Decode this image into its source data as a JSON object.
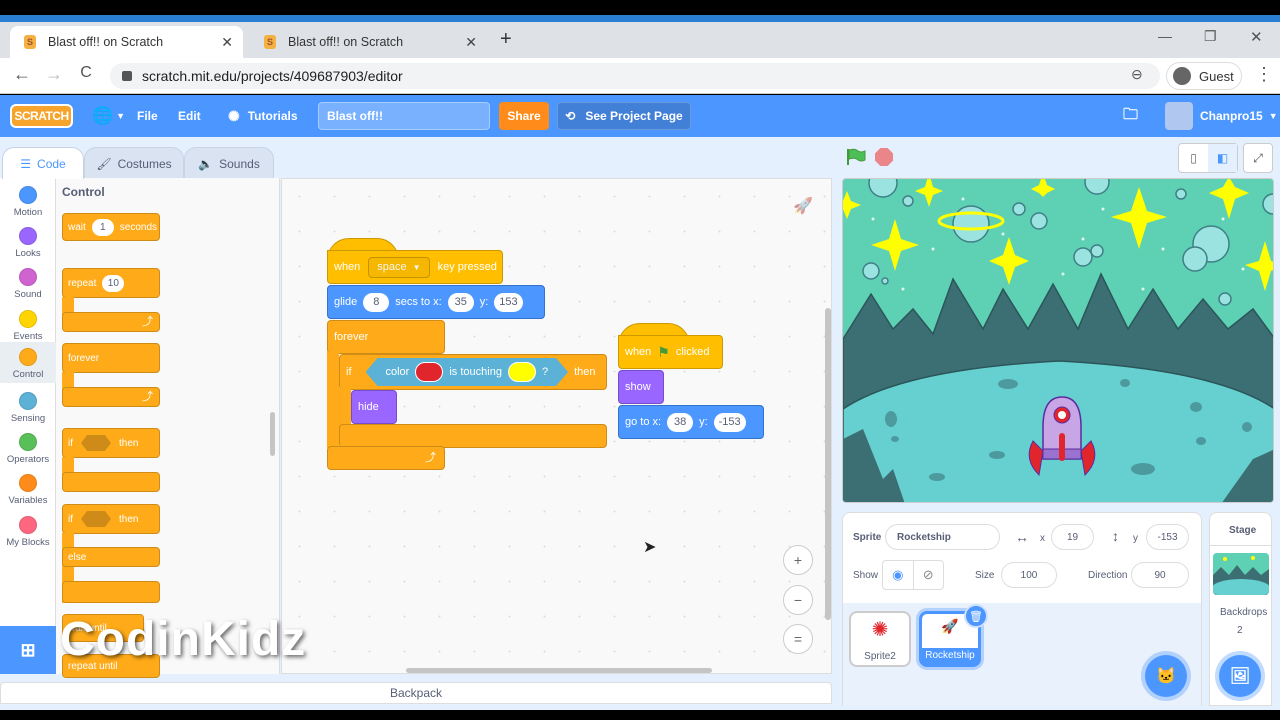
{
  "browser": {
    "tabs": [
      {
        "title": "Blast off!! on Scratch",
        "favicon": "S",
        "active": true
      },
      {
        "title": "Blast off!! on Scratch",
        "favicon": "S",
        "active": false
      }
    ],
    "new_tab": "+",
    "url": "scratch.mit.edu/projects/409687903/editor",
    "profile": "Guest",
    "window_controls": {
      "minimize": "—",
      "restore": "❐",
      "close": "✕"
    },
    "nav": {
      "back": "←",
      "forward": "→",
      "reload": "C"
    }
  },
  "menubar": {
    "logo": "SCRATCH",
    "globe_icon": "globe",
    "file": "File",
    "edit": "Edit",
    "tutorials": "Tutorials",
    "project_title": "Blast off!!",
    "share": "Share",
    "see_project_page": "See Project Page",
    "username": "Chanpro15"
  },
  "editor_tabs": [
    {
      "label": "Code",
      "icon": "code-icon",
      "active": true
    },
    {
      "label": "Costumes",
      "icon": "brush-icon",
      "active": false
    },
    {
      "label": "Sounds",
      "icon": "speaker-icon",
      "active": false
    }
  ],
  "categories": [
    {
      "label": "Motion",
      "color": "#4c97ff"
    },
    {
      "label": "Looks",
      "color": "#9966ff"
    },
    {
      "label": "Sound",
      "color": "#cf63cf"
    },
    {
      "label": "Events",
      "color": "#ffd500"
    },
    {
      "label": "Control",
      "color": "#ffab19",
      "active": true
    },
    {
      "label": "Sensing",
      "color": "#5cb1d6"
    },
    {
      "label": "Operators",
      "color": "#59c059"
    },
    {
      "label": "Variables",
      "color": "#ff8c1a"
    },
    {
      "label": "My Blocks",
      "color": "#ff6680"
    }
  ],
  "palette": {
    "title": "Control",
    "wait": {
      "label": "wait",
      "value": "1",
      "suffix": "seconds"
    },
    "repeat": {
      "label": "repeat",
      "value": "10"
    },
    "forever": "forever",
    "if_then": {
      "if": "if",
      "then": "then"
    },
    "if_else": {
      "if": "if",
      "then": "then",
      "else": "else"
    },
    "wait_until": "wait until",
    "repeat_until": "repeat until"
  },
  "scripts": {
    "script1": {
      "hat": {
        "when": "when",
        "key": "space",
        "suffix": "key pressed"
      },
      "glide": {
        "label": "glide",
        "secs": "8",
        "mid": "secs to x:",
        "x": "35",
        "ylabel": "y:",
        "y": "153"
      },
      "forever": "forever",
      "if": {
        "if": "if",
        "color": "color",
        "touching": "is touching",
        "q": "?",
        "then": "then",
        "color1": "#e0262c",
        "color2": "#ffff00"
      },
      "hide": "hide"
    },
    "script2": {
      "hat": {
        "when": "when",
        "suffix": "clicked"
      },
      "show": "show",
      "goto": {
        "label": "go to x:",
        "x": "38",
        "ylabel": "y:",
        "y": "-153"
      }
    }
  },
  "zoom_controls": {
    "zoom_in": "+",
    "zoom_out": "−",
    "reset": "="
  },
  "backpack": "Backpack",
  "watermark": "CodinKidz",
  "sprite_info": {
    "sprite_label": "Sprite",
    "sprite_name": "Rocketship",
    "x_label": "x",
    "x": "19",
    "y_label": "y",
    "y": "-153",
    "show_label": "Show",
    "size_label": "Size",
    "size": "100",
    "direction_label": "Direction",
    "direction": "90"
  },
  "sprites": [
    {
      "name": "Sprite2",
      "selected": false
    },
    {
      "name": "Rocketship",
      "selected": true
    }
  ],
  "stage_panel": {
    "label": "Stage",
    "backdrops_label": "Backdrops",
    "backdrops_count": "2"
  }
}
